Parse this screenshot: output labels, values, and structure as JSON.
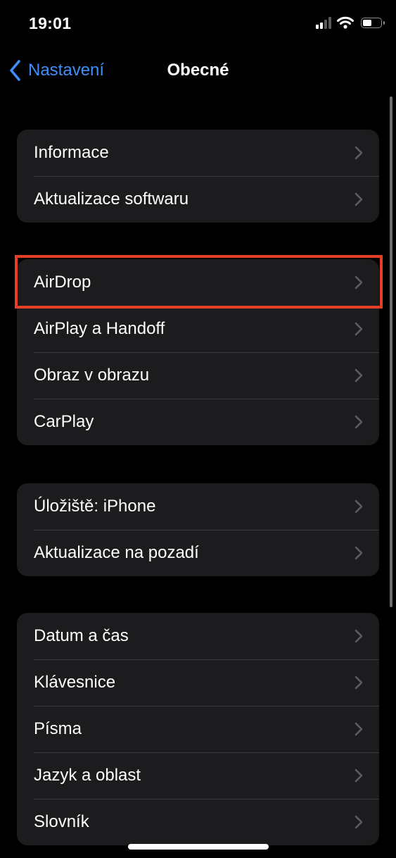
{
  "status_bar": {
    "time": "19:01"
  },
  "nav": {
    "back_label": "Nastavení",
    "title": "Obecné"
  },
  "groups": [
    {
      "items": [
        {
          "label": "Informace"
        },
        {
          "label": "Aktualizace softwaru"
        }
      ]
    },
    {
      "items": [
        {
          "label": "AirDrop"
        },
        {
          "label": "AirPlay a Handoff"
        },
        {
          "label": "Obraz v obrazu"
        },
        {
          "label": "CarPlay"
        }
      ]
    },
    {
      "items": [
        {
          "label": "Úložiště: iPhone"
        },
        {
          "label": "Aktualizace na pozadí"
        }
      ]
    },
    {
      "items": [
        {
          "label": "Datum a čas"
        },
        {
          "label": "Klávesnice"
        },
        {
          "label": "Písma"
        },
        {
          "label": "Jazyk a oblast"
        },
        {
          "label": "Slovník"
        }
      ]
    }
  ],
  "highlighted_item": "AirDrop",
  "colors": {
    "accent": "#3e8ff7",
    "highlight": "#e63f27",
    "cell_background": "#1c1c1e",
    "separator": "#38383a",
    "chevron": "#5b5b60"
  },
  "icons": {
    "back": "chevron-left-icon",
    "row_disclosure": "chevron-right-icon",
    "signal": "cellular-signal-icon",
    "wifi": "wifi-icon",
    "battery": "battery-icon"
  }
}
